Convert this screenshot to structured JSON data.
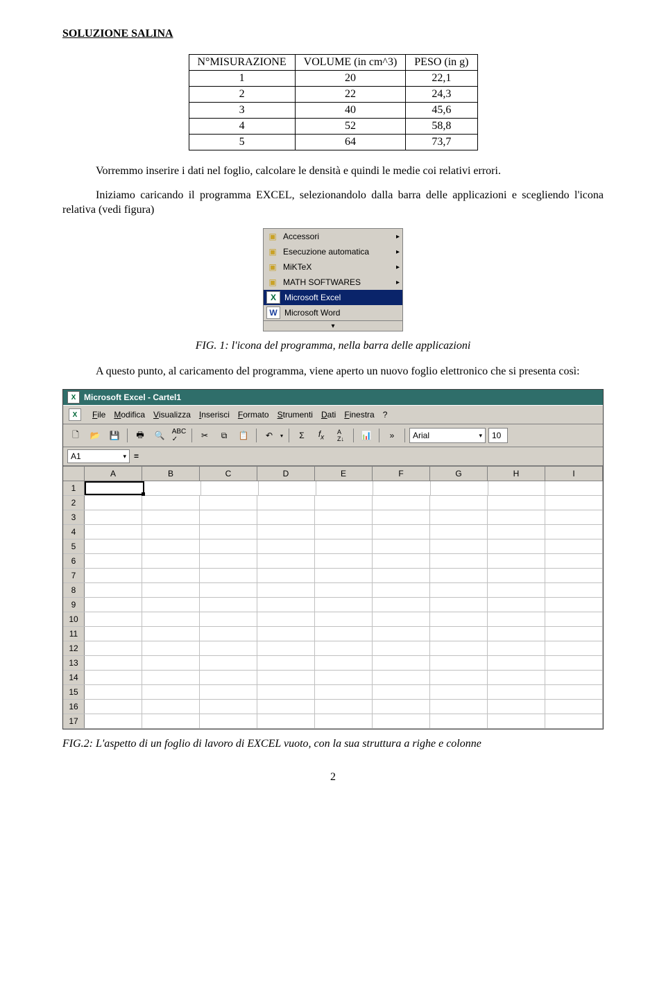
{
  "section_title": "SOLUZIONE SALINA",
  "chart_data": {
    "type": "table",
    "title": "",
    "columns": [
      "N°MISURAZIONE",
      "VOLUME (in cm^3)",
      "PESO (in g)"
    ],
    "rows": [
      [
        "1",
        "20",
        "22,1"
      ],
      [
        "2",
        "22",
        "24,3"
      ],
      [
        "3",
        "40",
        "45,6"
      ],
      [
        "4",
        "52",
        "58,8"
      ],
      [
        "5",
        "64",
        "73,7"
      ]
    ]
  },
  "para1": "Vorremmo inserire i dati nel foglio, calcolare le densità e quindi le medie coi relativi errori.",
  "para2": "Iniziamo caricando il programma EXCEL, selezionandolo dalla barra delle applicazioni e scegliendo l'icona relativa (vedi figura)",
  "caption1": "FIG. 1: l'icona del programma, nella barra delle applicazioni",
  "para3": "A questo punto, al caricamento del programma, viene aperto un nuovo foglio elettronico che si presenta così:",
  "caption2": "FIG.2: L'aspetto di un foglio di lavoro di EXCEL vuoto, con la sua struttura a righe e colonne",
  "page_number": "2",
  "startmenu": {
    "items": [
      {
        "label": "Accessori",
        "icon": "folder",
        "arrow": true
      },
      {
        "label": "Esecuzione automatica",
        "icon": "folder",
        "arrow": true
      },
      {
        "label": "MiKTeX",
        "icon": "folder",
        "arrow": true
      },
      {
        "label": "MATH SOFTWARES",
        "icon": "folder",
        "arrow": true
      },
      {
        "label": "Microsoft Excel",
        "icon": "excel",
        "arrow": false,
        "selected": true
      },
      {
        "label": "Microsoft Word",
        "icon": "word",
        "arrow": false
      }
    ]
  },
  "excel": {
    "title": "Microsoft Excel - Cartel1",
    "menubar": [
      {
        "u": "F",
        "rest": "ile"
      },
      {
        "u": "M",
        "rest": "odifica"
      },
      {
        "u": "V",
        "rest": "isualizza"
      },
      {
        "u": "I",
        "rest": "nserisci"
      },
      {
        "u": "F",
        "rest": "ormat",
        "pre": "",
        "post": "o"
      },
      {
        "u": "S",
        "rest": "trumenti"
      },
      {
        "u": "D",
        "rest": "ati"
      },
      {
        "u": "F",
        "rest": "inestr",
        "pre": "",
        "post": "a"
      },
      {
        "u": "?",
        "rest": ""
      }
    ],
    "menubar_labels": [
      "File",
      "Modifica",
      "Visualizza",
      "Inserisci",
      "Formato",
      "Strumenti",
      "Dati",
      "Finestra",
      "?"
    ],
    "menubar_mnem": [
      "F",
      "M",
      "V",
      "I",
      "F",
      "S",
      "D",
      "F",
      "?"
    ],
    "font_name": "Arial",
    "font_size": "10",
    "name_box": "A1",
    "columns": [
      "A",
      "B",
      "C",
      "D",
      "E",
      "F",
      "G",
      "H",
      "I"
    ],
    "row_count": 17
  }
}
